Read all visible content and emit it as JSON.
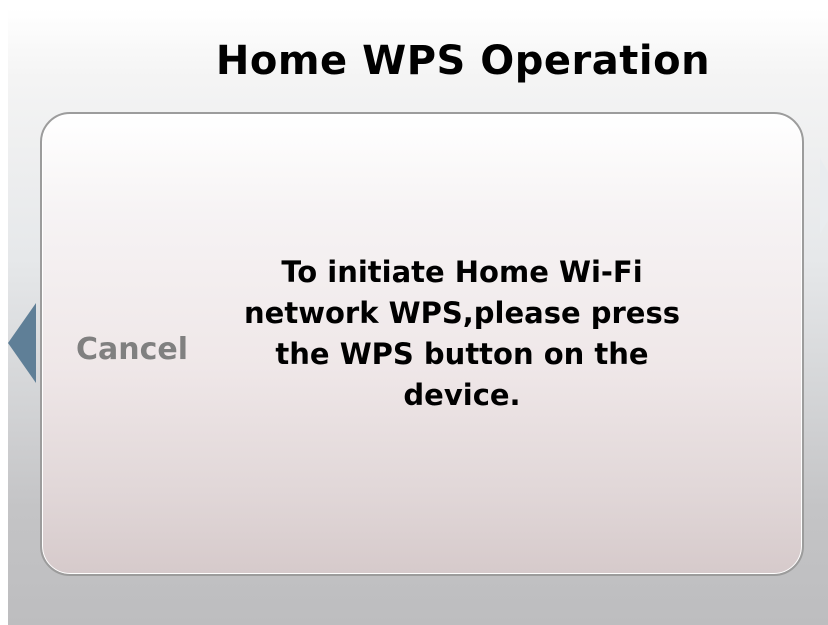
{
  "header": {
    "title": "Home WPS Operation"
  },
  "dialog": {
    "cancel_label": "Cancel",
    "message": "To initiate Home Wi-Fi network WPS,please press the WPS button on the device."
  },
  "colors": {
    "back_arrow": "#5f7f97",
    "cancel_text": "#808080",
    "dialog_border": "#9c9c9c"
  },
  "icons": {
    "back": "left-triangle-arrow-icon",
    "next": "right-triangle-arrow-icon"
  }
}
